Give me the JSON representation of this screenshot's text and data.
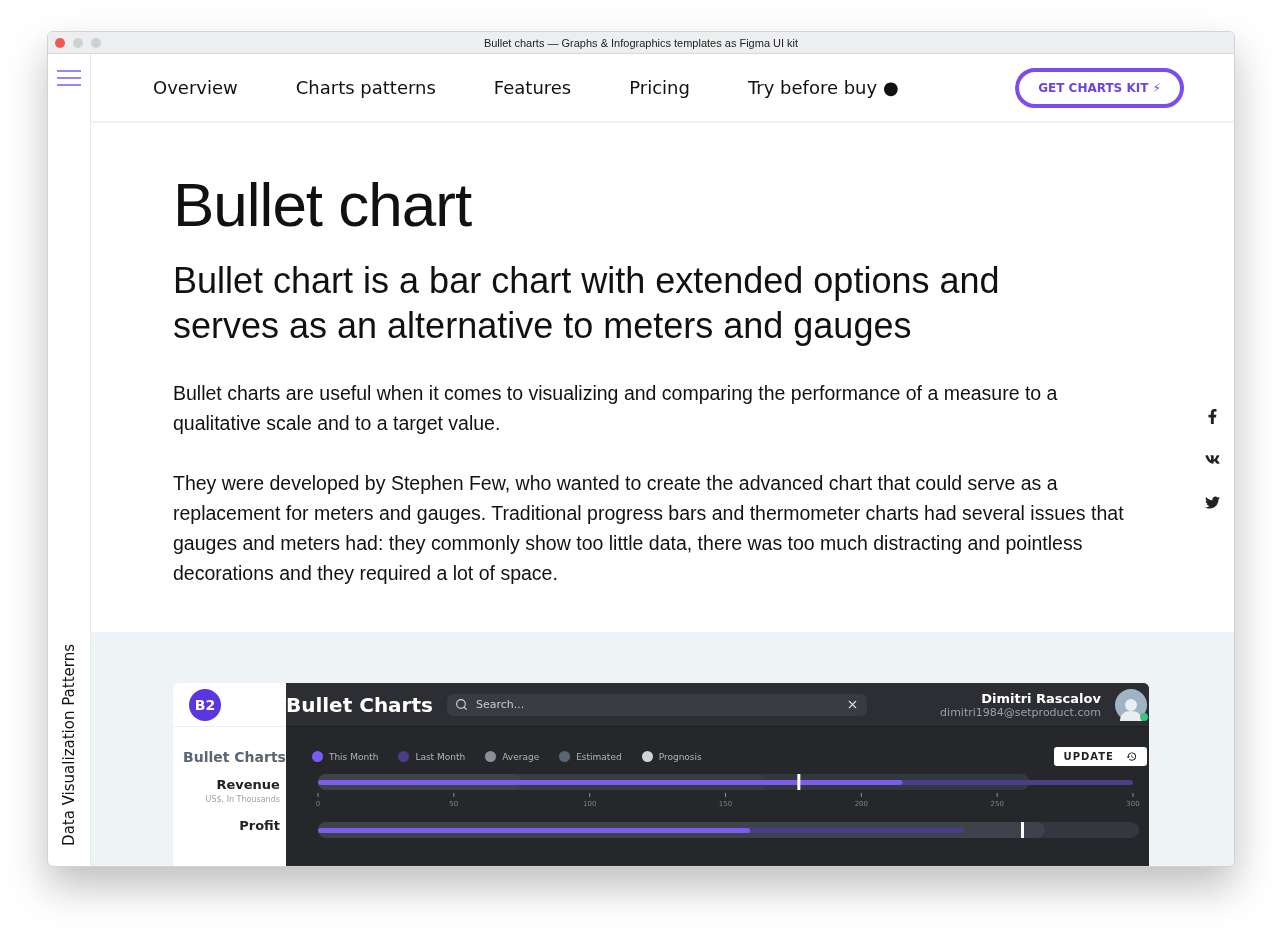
{
  "window": {
    "title": "Bullet charts — Graphs & Infographics templates as Figma UI kit"
  },
  "sidebar": {
    "label": "Data Visualization Patterns"
  },
  "nav": {
    "items": [
      {
        "label": "Overview"
      },
      {
        "label": "Charts patterns"
      },
      {
        "label": "Features"
      },
      {
        "label": "Pricing"
      },
      {
        "label": "Try before buy ●"
      }
    ],
    "cta": "GET CHARTS KIT ⚡"
  },
  "article": {
    "title": "Bullet chart",
    "lead": "Bullet chart is a bar chart with extended options and serves as an alternative to meters and gauges",
    "paragraphs": [
      "Bullet charts are useful when it comes to visualizing and comparing the performance of a measure to a qualitative scale and to a target value.",
      "They were developed by Stephen Few, who wanted to create the advanced chart that could serve as a replacement for meters and gauges. Traditional progress bars and thermometer charts had several issues that gauges and meters had: they commonly show too little data, there was too much distracting and pointless decorations and they required a lot of space."
    ]
  },
  "social": [
    {
      "kind": "facebook"
    },
    {
      "kind": "vk"
    },
    {
      "kind": "twitter"
    }
  ],
  "mockup": {
    "logo": "B2",
    "title": "Bullet Charts",
    "search": {
      "placeholder": "Search..."
    },
    "user": {
      "name": "Dimitri Rascalov",
      "email": "dimitri1984@setproduct.com",
      "online": true
    },
    "section_title": "Bullet Charts",
    "update_button": "UPDATE",
    "legend": [
      {
        "label": "This Month",
        "color": "#7b5cf0"
      },
      {
        "label": "Last Month",
        "color": "#4b3c8c"
      },
      {
        "label": "Average",
        "color": "#8a8f98"
      },
      {
        "label": "Estimated",
        "color": "#5c6673"
      },
      {
        "label": "Prognosis",
        "color": "#d0d3d8"
      }
    ],
    "rows": [
      {
        "label": "Revenue",
        "unit": "US$, In Thousands",
        "ticks": [
          "0",
          "50",
          "100",
          "150",
          "200",
          "250",
          "300"
        ]
      },
      {
        "label": "Profit"
      }
    ]
  }
}
